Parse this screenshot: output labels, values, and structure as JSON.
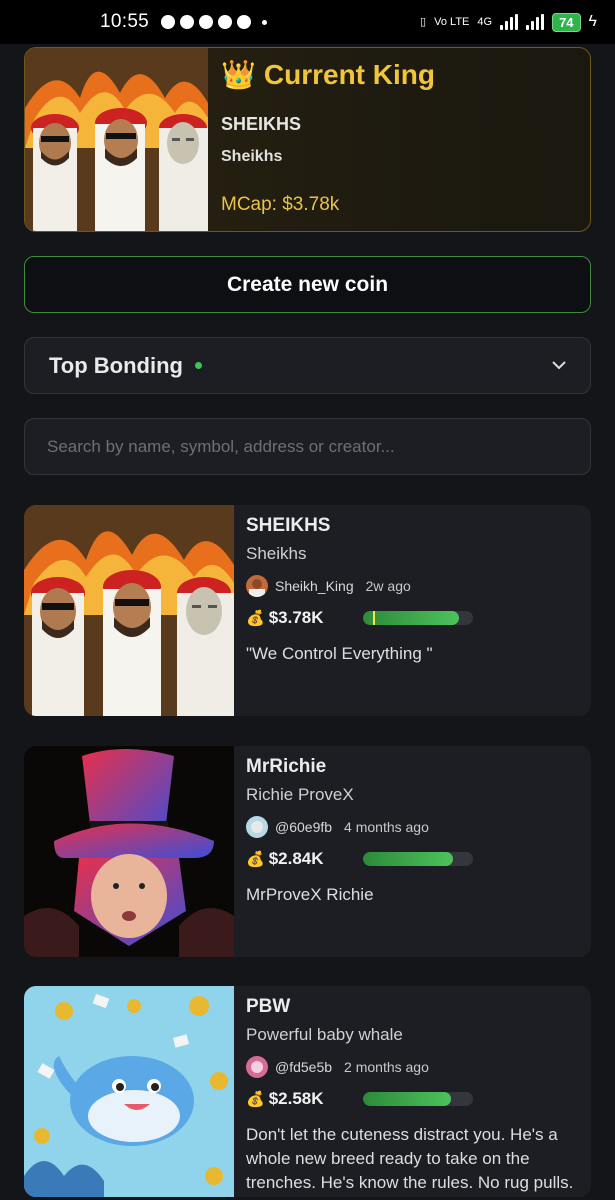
{
  "status_bar": {
    "time": "10:55",
    "network_label": "Vo LTE",
    "network_type": "4G",
    "battery": "74"
  },
  "king": {
    "title": "Current King",
    "symbol": "SHEIKHS",
    "name": "Sheikhs",
    "mcap": "MCap: $3.78k"
  },
  "create_button": {
    "label": "Create new coin"
  },
  "sort": {
    "label": "Top Bonding"
  },
  "search": {
    "placeholder": "Search by name, symbol, address or creator..."
  },
  "coins": [
    {
      "symbol": "SHEIKHS",
      "name": "Sheikhs",
      "creator": "Sheikh_King",
      "age": "2w ago",
      "mcap": "$3.78K",
      "progress": 0.88,
      "description": "\"We Control Everything \""
    },
    {
      "symbol": "MrRichie",
      "name": "Richie ProveX",
      "creator": "@60e9fb",
      "age": "4 months ago",
      "mcap": "$2.84K",
      "progress": 0.82,
      "description": "MrProveX Richie"
    },
    {
      "symbol": "PBW",
      "name": "Powerful baby whale",
      "creator": "@fd5e5b",
      "age": "2 months ago",
      "mcap": "$2.58K",
      "progress": 0.8,
      "description": "Don't let the cuteness distract you. He's a whole new breed ready to take on the trenches. He's know the rules. No rug pulls."
    }
  ],
  "colors": {
    "background": "#141519",
    "card": "#1d1e23",
    "king_gold": "#f0c53a",
    "progress_green": "#4cc25c",
    "create_border": "#3f8a3f"
  }
}
